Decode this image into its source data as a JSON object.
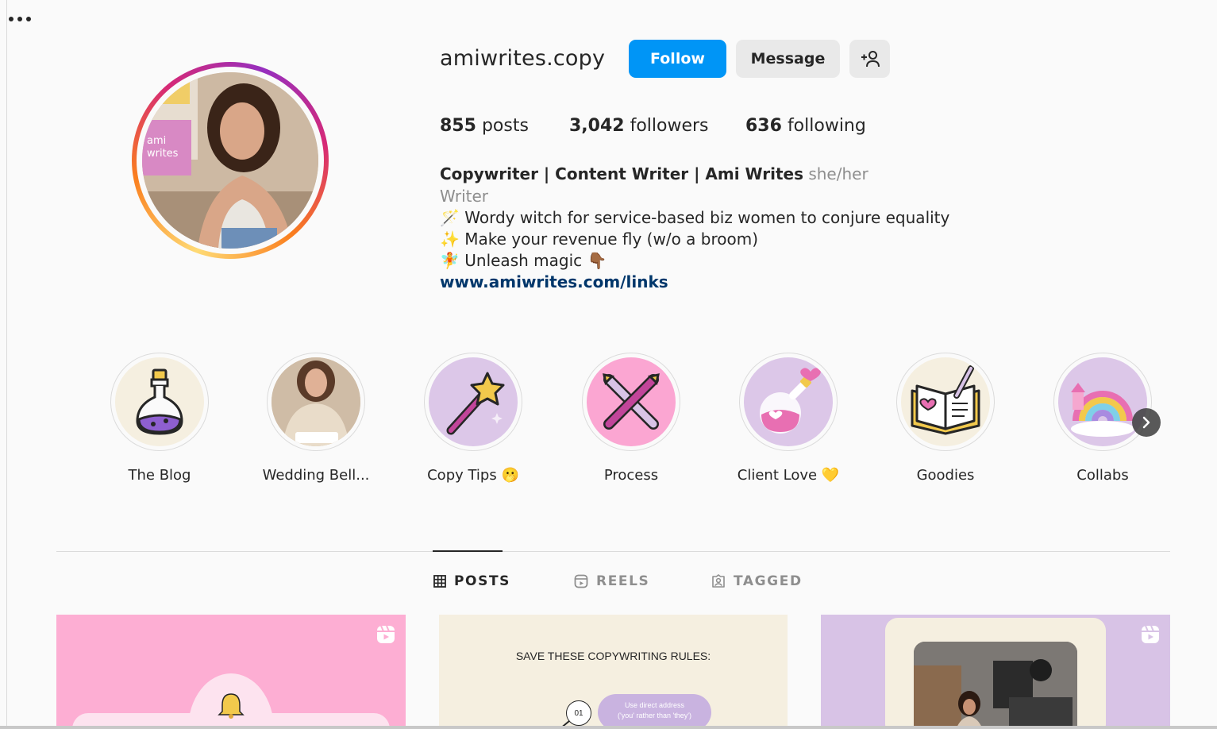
{
  "profile": {
    "username": "amiwrites.copy",
    "follow_label": "Follow",
    "message_label": "Message",
    "stats": {
      "posts_count": "855",
      "posts_label": "posts",
      "followers_count": "3,042",
      "followers_label": "followers",
      "following_count": "636",
      "following_label": "following"
    },
    "bio": {
      "name": "Copywriter | Content Writer | Ami Writes",
      "pronouns": "she/her",
      "category": "Writer",
      "line1": "🪄 Wordy witch for service-based biz women to conjure equality",
      "line2": "✨ Make your revenue fly (w/o a broom)",
      "line3": "🧚 Unleash magic 👇🏾",
      "link": "www.amiwrites.com/links"
    }
  },
  "highlights": [
    {
      "label": "The Blog",
      "icon": "potion-bottle-icon"
    },
    {
      "label": "Wedding Bell...",
      "icon": "photo"
    },
    {
      "label": "Copy Tips 🫢",
      "icon": "magic-wand-icon"
    },
    {
      "label": "Process",
      "icon": "crossed-pens-icon"
    },
    {
      "label": "Client Love 💛",
      "icon": "love-potion-icon"
    },
    {
      "label": "Goodies",
      "icon": "open-book-icon"
    },
    {
      "label": "Collabs",
      "icon": "rainbow-castle-icon"
    }
  ],
  "tabs": [
    {
      "label": "POSTS",
      "icon": "grid-icon",
      "active": true
    },
    {
      "label": "REELS",
      "icon": "reels-icon",
      "active": false
    },
    {
      "label": "TAGGED",
      "icon": "tagged-icon",
      "active": false
    }
  ],
  "posts": {
    "post2_heading": "SAVE THESE COPYWRITING RULES:",
    "post2_step_number": "01",
    "post2_step_text_1": "Use direct address",
    "post2_step_text_2": "('you' rather than 'they')"
  },
  "colors": {
    "follow_blue": "#0095f6",
    "link_blue": "#00376b",
    "secondary_gray": "#8e8e8e"
  }
}
